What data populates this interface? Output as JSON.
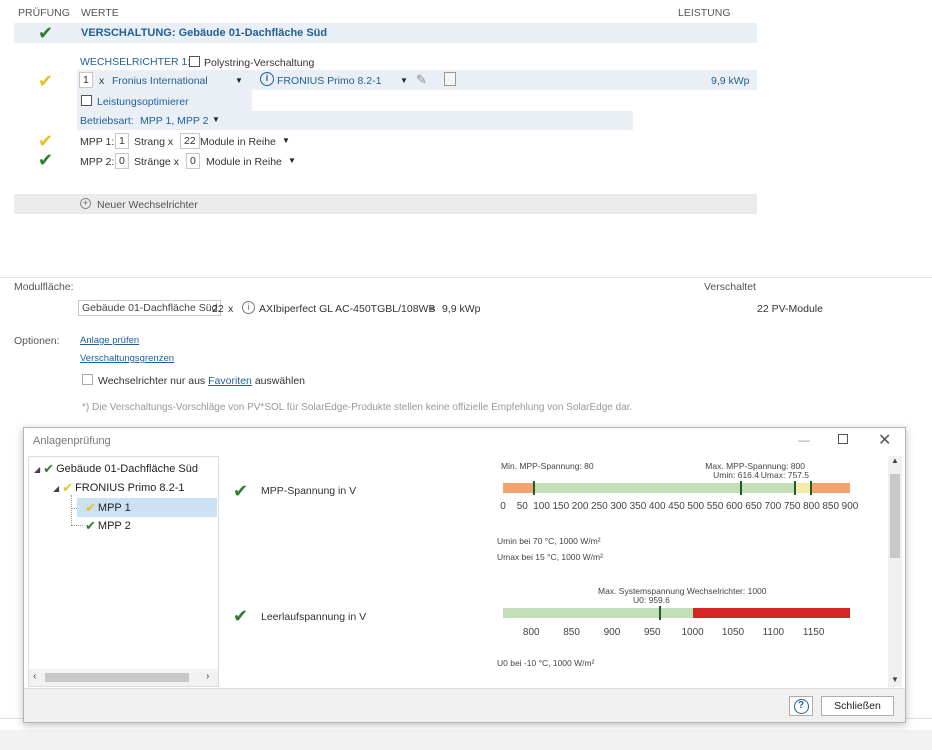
{
  "headers": {
    "check": "PRÜFUNG",
    "values": "WERTE",
    "power": "LEISTUNG"
  },
  "circuit": {
    "title": "VERSCHALTUNG: Gebäude 01-Dachfläche Süd",
    "inverter_label": "WECHSELRICHTER 1:",
    "polystring_label": "Polystring-Verschaltung",
    "qty": "1",
    "x": "x",
    "manufacturer": "Fronius International",
    "model": "FRONIUS Primo 8.2-1",
    "power": "9,9 kWp",
    "optimizer_label": "Leistungsoptimierer",
    "mode_label": "Betriebsart:",
    "mode_value": "MPP 1, MPP 2",
    "mpp1": {
      "label": "MPP 1:",
      "strings": "1",
      "strings_label": "Strang x",
      "modules": "22",
      "modules_label": "Module in Reihe"
    },
    "mpp2": {
      "label": "MPP 2:",
      "strings": "0",
      "strings_label": "Stränge x",
      "modules": "0",
      "modules_label": "Module in Reihe"
    },
    "new_inverter": "Neuer Wechselrichter"
  },
  "module_area": {
    "label": "Modulfläche:",
    "wired_label": "Verschaltet",
    "area_value": "Gebäude 01-Dachfläche Süd",
    "count": "22",
    "x": "x",
    "module": "AXIbiperfect GL AC-450TGBL/108WB",
    "eq": "=",
    "power": "9,9 kWp",
    "wired_value": "22 PV-Module"
  },
  "options": {
    "label": "Optionen:",
    "check_link": "Anlage prüfen",
    "limits_link": "Verschaltungsgrenzen",
    "fav_prefix": "Wechselrichter nur aus",
    "fav_link": "Favoriten",
    "fav_suffix": "auswählen",
    "note": "*) Die Verschaltungs-Vorschläge von PV*SOL für SolarEdge-Produkte stellen keine offizielle Empfehlung von SolarEdge dar."
  },
  "dialog": {
    "title": "Anlagenprüfung",
    "tree": {
      "root": "Gebäude 01-Dachfläche Süd",
      "inverter": "FRONIUS Primo 8.2-1",
      "mpp1": "MPP 1",
      "mpp2": "MPP 2"
    },
    "mpp_voltage": {
      "label": "MPP-Spannung in V",
      "min_label": "Min. MPP-Spannung: 80",
      "max_label": "Max. MPP-Spannung: 800",
      "umin_label": "Umin: 616.4",
      "umax_label": "Umax: 757.5",
      "axis_min": 0,
      "axis_max": 900,
      "ticks": [
        "0",
        "50",
        "100",
        "150",
        "200",
        "250",
        "300",
        "350",
        "400",
        "450",
        "500",
        "550",
        "600",
        "650",
        "700",
        "750",
        "800",
        "850",
        "900"
      ],
      "mpp_min": 80,
      "mpp_max": 800,
      "umin": 616.4,
      "umax": 757.5,
      "note1": "Umin bei 70 °C, 1000 W/m²",
      "note2": "Umax bei 15 °C, 1000 W/m²"
    },
    "open_circuit": {
      "label": "Leerlaufspannung in V",
      "max_label": "Max. Systemspannung Wechselrichter: 1000",
      "u0_label": "U0: 959.6",
      "axis_min": 765,
      "axis_max": 1195,
      "ticks": [
        "800",
        "850",
        "900",
        "950",
        "1000",
        "1050",
        "1100",
        "1150"
      ],
      "max": 1000,
      "u0": 959.6,
      "note": "U0 bei -10 °C, 1000 W/m²"
    },
    "close_button": "Schließen",
    "help_icon": "?"
  },
  "colors": {
    "green_check": "#2e7d32",
    "yellow_check": "#e6c229",
    "bar_green": "#c3dfb7",
    "bar_orange": "#f3a46e",
    "bar_yellow": "#f6ecaa",
    "bar_red": "#d42424"
  }
}
